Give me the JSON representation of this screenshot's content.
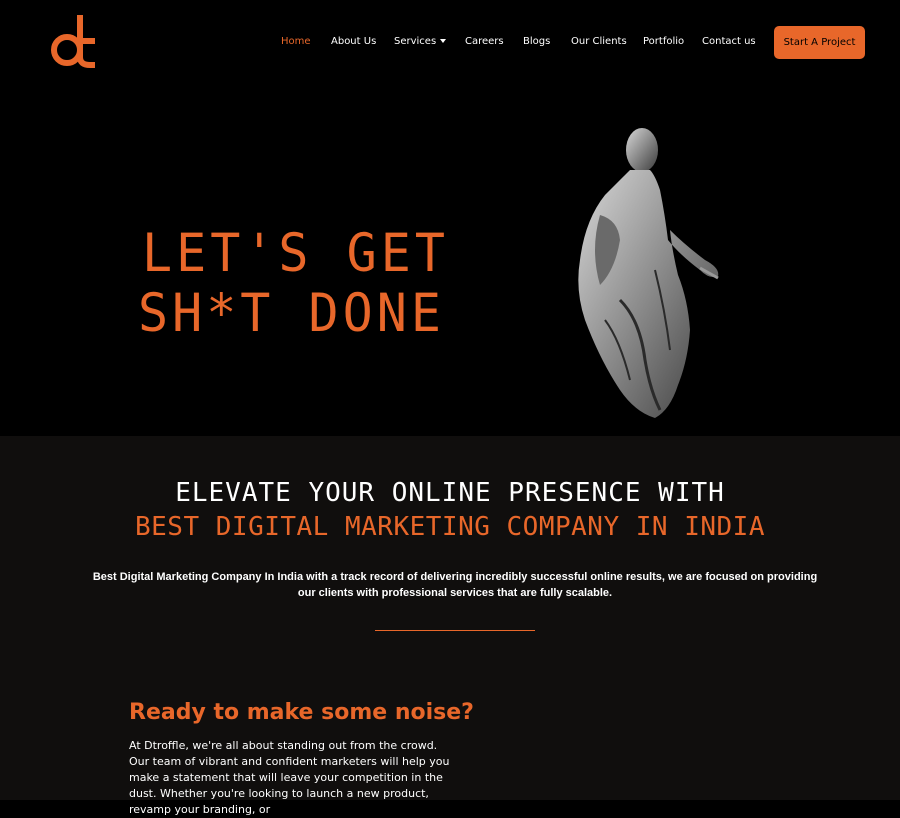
{
  "brand": {
    "logo_text": "dt",
    "accent": "#e8672a"
  },
  "nav": {
    "items": [
      {
        "label": "Home",
        "active": true
      },
      {
        "label": "About Us"
      },
      {
        "label": "Services",
        "has_dropdown": true
      },
      {
        "label": "Careers"
      },
      {
        "label": "Blogs"
      },
      {
        "label": "Our Clients"
      },
      {
        "label": "Portfolio"
      },
      {
        "label": "Contact us"
      }
    ],
    "cta_label": "Start A Project"
  },
  "hero": {
    "line1": "LET'S GET",
    "line2": "SH*T DONE",
    "image": "roman-statue"
  },
  "intro": {
    "title_line1": "ELEVATE YOUR ONLINE PRESENCE WITH",
    "title_line2": "BEST DIGITAL MARKETING COMPANY IN INDIA",
    "description": "Best Digital Marketing Company In India with a track record of delivering incredibly successful online results, we are focused on providing our clients with professional services that are fully scalable."
  },
  "noise": {
    "title": "Ready to make some noise?",
    "body": "At Dtroffle, we're all about standing out from the crowd. Our team of vibrant and confident marketers will help you make a statement that will leave your competition in the dust. Whether you're looking to launch a new product, revamp your branding, or"
  }
}
